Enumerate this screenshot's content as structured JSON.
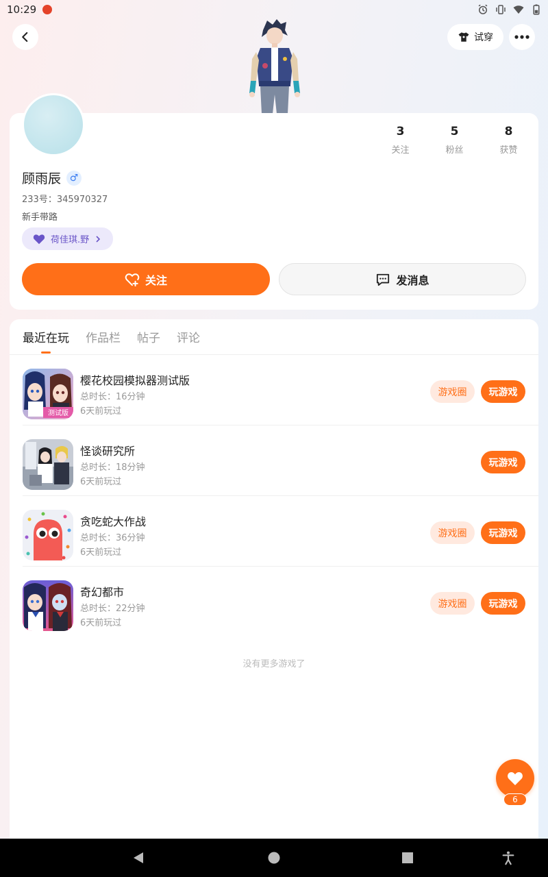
{
  "status_bar": {
    "time": "10:29"
  },
  "top_bar": {
    "try_on_label": "试穿"
  },
  "profile": {
    "name": "顾雨辰",
    "gender_symbol": "♂",
    "uid": "233号：345970327",
    "title": "新手带路",
    "friend_tag": "荷佳琪.野",
    "stats": [
      {
        "value": "3",
        "label": "关注"
      },
      {
        "value": "5",
        "label": "粉丝"
      },
      {
        "value": "8",
        "label": "获赞"
      }
    ],
    "follow_label": "关注",
    "message_label": "发消息"
  },
  "tabs": [
    {
      "label": "最近在玩",
      "active": true
    },
    {
      "label": "作品栏",
      "active": false
    },
    {
      "label": "帖子",
      "active": false
    },
    {
      "label": "评论",
      "active": false
    }
  ],
  "games": [
    {
      "name": "樱花校园模拟器测试版",
      "duration": "总时长：16分钟",
      "last_played": "6天前玩过",
      "has_circle": true,
      "circle_label": "游戏圈",
      "play_label": "玩游戏",
      "icon_label": "测试版"
    },
    {
      "name": "怪谈研究所",
      "duration": "总时长：18分钟",
      "last_played": "6天前玩过",
      "has_circle": false,
      "circle_label": "",
      "play_label": "玩游戏",
      "icon_label": ""
    },
    {
      "name": "贪吃蛇大作战",
      "duration": "总时长：36分钟",
      "last_played": "6天前玩过",
      "has_circle": true,
      "circle_label": "游戏圈",
      "play_label": "玩游戏",
      "icon_label": ""
    },
    {
      "name": "奇幻都市",
      "duration": "总时长：22分钟",
      "last_played": "6天前玩过",
      "has_circle": true,
      "circle_label": "游戏圈",
      "play_label": "玩游戏",
      "icon_label": ""
    }
  ],
  "no_more_text": "没有更多游戏了",
  "like_fab": {
    "count": "6"
  },
  "colors": {
    "accent": "#ff6f18",
    "accent_light": "#ffe9df",
    "tag_purple": "#6a55c8"
  }
}
